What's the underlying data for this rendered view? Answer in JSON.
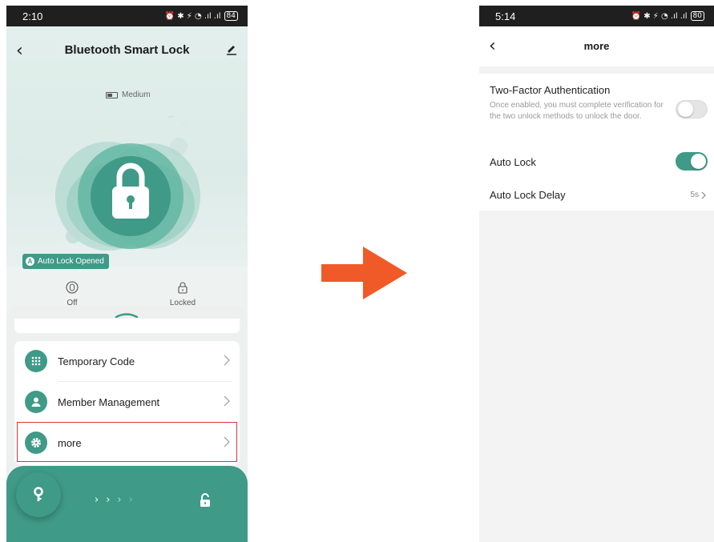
{
  "left_screen": {
    "status_bar": {
      "time": "2:10",
      "icons": "⏰ ✱ ⚡ ◔ .ıl .ıl",
      "battery": "84"
    },
    "header": {
      "title": "Bluetooth Smart Lock"
    },
    "battery_label": "Medium",
    "auto_lock_badge": "Auto Lock Opened",
    "states": [
      {
        "icon": "shield-icon",
        "label": "Off"
      },
      {
        "icon": "padlock-icon",
        "label": "Locked"
      }
    ],
    "menu_items": [
      {
        "icon": "keypad-icon",
        "label": "Temporary Code"
      },
      {
        "icon": "person-icon",
        "label": "Member Management"
      },
      {
        "icon": "gear-icon",
        "label": "more"
      }
    ],
    "highlight_color": "#d9343a",
    "accent": "#3f9a87"
  },
  "arrow_color": "#f05a28",
  "right_screen": {
    "status_bar": {
      "time": "5:14",
      "icons": "⏰ ✱ ⚡ ◔ .ıl .ıl",
      "battery": "80"
    },
    "header": {
      "title": "more"
    },
    "settings": {
      "two_factor": {
        "title": "Two-Factor Authentication",
        "description": "Once enabled, you must complete verification for the two unlock methods to unlock the door.",
        "enabled": false
      },
      "auto_lock": {
        "title": "Auto Lock",
        "enabled": true
      },
      "auto_lock_delay": {
        "title": "Auto Lock Delay",
        "value": "5s"
      }
    }
  }
}
